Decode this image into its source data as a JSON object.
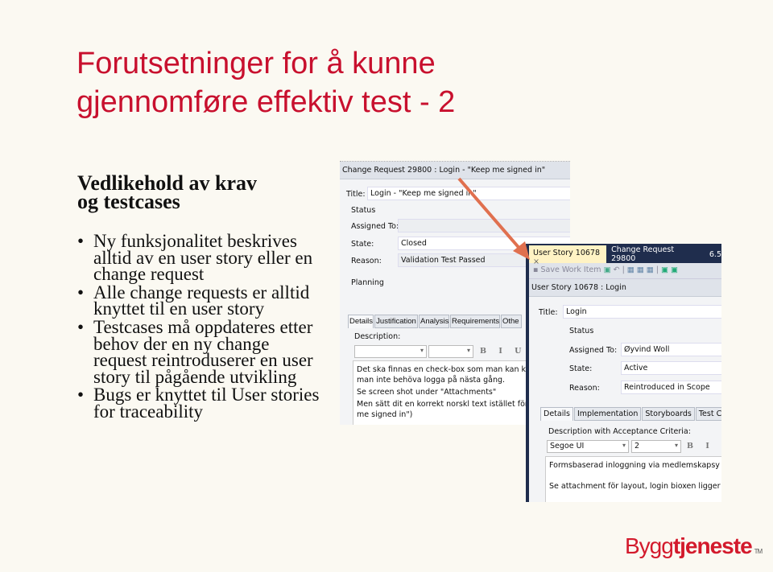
{
  "slide": {
    "title_line1": "Forutsetninger for å kunne",
    "title_line2": "gjennomføre effektiv test - 2",
    "subhead_line1": "Vedlikehold av krav",
    "subhead_line2": "og testcases",
    "bullets": [
      "Ny funksjonalitet beskrives alltid av en user story eller en change request",
      "Alle change requests er alltid knyttet til en user story",
      "Testcases må oppdateres etter behov der en ny change request reintroduserer en user story til pågående utvikling",
      "Bugs er knyttet til User stories for traceability"
    ]
  },
  "change_request": {
    "header": "Change Request 29800 : Login - \"Keep me signed in\"",
    "title_label": "Title:",
    "title_value": "Login - \"Keep me signed in\"",
    "status_label": "Status",
    "assigned_label": "Assigned To:",
    "assigned_value": "",
    "state_label": "State:",
    "state_value": "Closed",
    "reason_label": "Reason:",
    "reason_value": "Validation Test Passed",
    "planning_label": "Planning",
    "tabs": [
      "Details",
      "Justification",
      "Analysis",
      "Requirements",
      "Othe"
    ],
    "description_label": "Description:",
    "format_buttons": "B I U",
    "description_lines": [
      "Det ska finnas en check-box som man kan klicka",
      "man inte behöva logga på nästa gång.",
      "Se screen shot under \"Attachments\"",
      "Men sätt dit en korrekt norskl text istället för det",
      "me signed in\")"
    ]
  },
  "user_story": {
    "tab_active": "User Story 10678",
    "tab_close": "×",
    "tab_other": "Change Request 29800",
    "tab_extra": "6.5",
    "save_label": "Save Work Item",
    "header": "User Story 10678 : Login",
    "title_label": "Title:",
    "title_value": "Login",
    "status_label": "Status",
    "assigned_label": "Assigned To:",
    "assigned_value": "Øyvind Woll",
    "state_label": "State:",
    "state_value": "Active",
    "reason_label": "Reason:",
    "reason_value": "Reintroduced in Scope",
    "tabs": [
      "Details",
      "Implementation",
      "Storyboards",
      "Test Cas"
    ],
    "description_label": "Description with Acceptance Criteria:",
    "font_value": "Segoe UI",
    "size_value": "2",
    "format_buttons": "B I",
    "description_lines": [
      "Formsbaserad inloggning via medlemskapsy",
      "Se attachment för layout, login bioxen ligger"
    ]
  },
  "logo": {
    "text_a": "Bygg",
    "text_b": "tjeneste",
    "tm": "TM"
  },
  "colors": {
    "title": "#c8102e",
    "arrow": "#e0704f",
    "frame": "#1f2d4d"
  }
}
